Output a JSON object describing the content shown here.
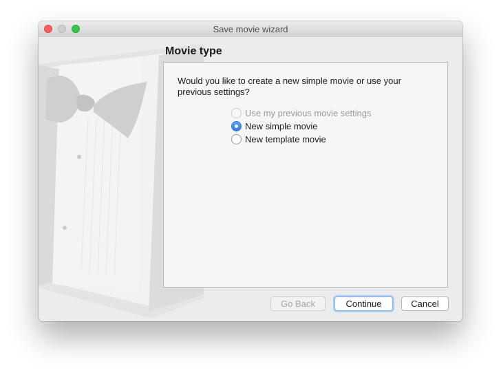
{
  "window": {
    "title": "Save movie wizard"
  },
  "page": {
    "heading": "Movie type",
    "question": "Would you like to create a new simple movie or use your previous settings?"
  },
  "options": [
    {
      "label": "Use my previous movie settings",
      "state": "disabled"
    },
    {
      "label": "New simple movie",
      "state": "selected"
    },
    {
      "label": "New template movie",
      "state": "unselected"
    }
  ],
  "buttons": {
    "back": "Go Back",
    "continue": "Continue",
    "cancel": "Cancel"
  },
  "colors": {
    "accent": "#2b7fe5",
    "close": "#fc605c",
    "zoom": "#34c84a",
    "window_bg": "#ececec"
  },
  "icons": {
    "watermark": "tuxedo-bowtie-icon"
  }
}
